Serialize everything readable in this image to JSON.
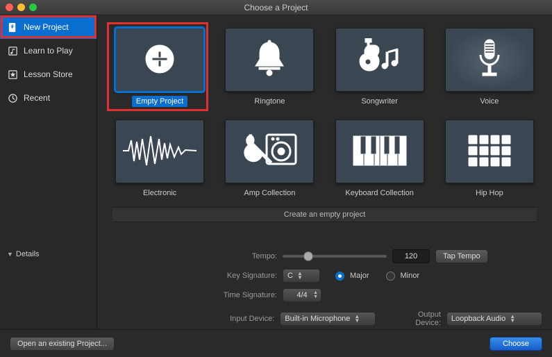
{
  "window": {
    "title": "Choose a Project"
  },
  "sidebar": {
    "items": [
      {
        "label": "New Project",
        "icon": "plus-doc-icon"
      },
      {
        "label": "Learn to Play",
        "icon": "note-icon"
      },
      {
        "label": "Lesson Store",
        "icon": "star-icon"
      },
      {
        "label": "Recent",
        "icon": "clock-icon"
      }
    ]
  },
  "tiles": [
    {
      "label": "Empty Project",
      "icon": "plus-circle"
    },
    {
      "label": "Ringtone",
      "icon": "bell"
    },
    {
      "label": "Songwriter",
      "icon": "guitar"
    },
    {
      "label": "Voice",
      "icon": "mic"
    },
    {
      "label": "Electronic",
      "icon": "wave"
    },
    {
      "label": "Amp Collection",
      "icon": "amp"
    },
    {
      "label": "Keyboard Collection",
      "icon": "keys"
    },
    {
      "label": "Hip Hop",
      "icon": "pads"
    }
  ],
  "description": "Create an empty project",
  "details": {
    "toggle_label": "Details",
    "tempo_label": "Tempo:",
    "tempo_value": "120",
    "tap_tempo": "Tap Tempo",
    "key_sig_label": "Key Signature:",
    "key_sig_value": "C",
    "major_label": "Major",
    "minor_label": "Minor",
    "time_sig_label": "Time Signature:",
    "time_sig_value": "4/4",
    "input_device_label": "Input Device:",
    "input_device_value": "Built-in Microphone",
    "output_device_label": "Output Device:",
    "output_device_value": "Loopback Audio"
  },
  "footer": {
    "open_existing": "Open an existing Project...",
    "choose": "Choose"
  }
}
